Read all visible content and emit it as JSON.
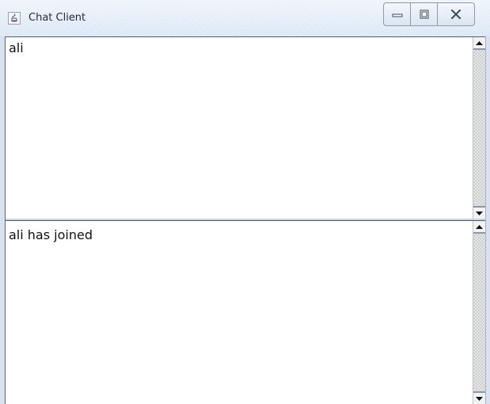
{
  "window": {
    "title": "Chat Client",
    "controls": [
      {
        "name": "minimize",
        "icon": "minimize-icon"
      },
      {
        "name": "maximize",
        "icon": "maximize-icon"
      },
      {
        "name": "close",
        "icon": "close-icon"
      }
    ]
  },
  "user_list": {
    "items": [
      "ali"
    ]
  },
  "messages": {
    "lines": [
      "ali has joined"
    ]
  },
  "colors": {
    "titlebar": "#dfe9f5",
    "frame_border": "#4e5f73",
    "text": "#111111"
  }
}
